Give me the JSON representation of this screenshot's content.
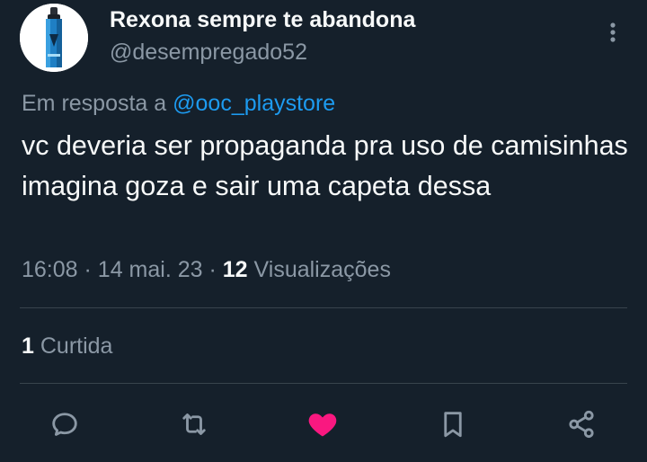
{
  "author": {
    "display_name": "Rexona sempre te abandona",
    "handle": "@desempregado52",
    "avatar_icon": "deodorant-can-icon"
  },
  "reply": {
    "prefix": "Em resposta a",
    "mention": "@ooc_playstore"
  },
  "tweet": {
    "text": "vc deveria ser propaganda pra uso de camisinhas imagina goza e sair uma capeta dessa"
  },
  "meta": {
    "time": "16:08",
    "separator1": "·",
    "date": "14 mai. 23",
    "separator2": "·",
    "views_count": "12",
    "views_label": "Visualizações"
  },
  "engagement": {
    "likes_count": "1",
    "likes_label": "Curtida"
  },
  "actions": [
    {
      "name": "reply",
      "icon": "speech-bubble-icon"
    },
    {
      "name": "retweet",
      "icon": "retweet-arrows-icon"
    },
    {
      "name": "like",
      "icon": "heart-icon",
      "active": true
    },
    {
      "name": "bookmark",
      "icon": "bookmark-icon"
    },
    {
      "name": "share",
      "icon": "share-icon"
    }
  ],
  "colors": {
    "background": "#15202b",
    "text_primary": "#f7f9f9",
    "text_secondary": "#8b98a5",
    "link": "#1d9bf0",
    "like_active": "#f91880",
    "divider": "#38444d"
  }
}
